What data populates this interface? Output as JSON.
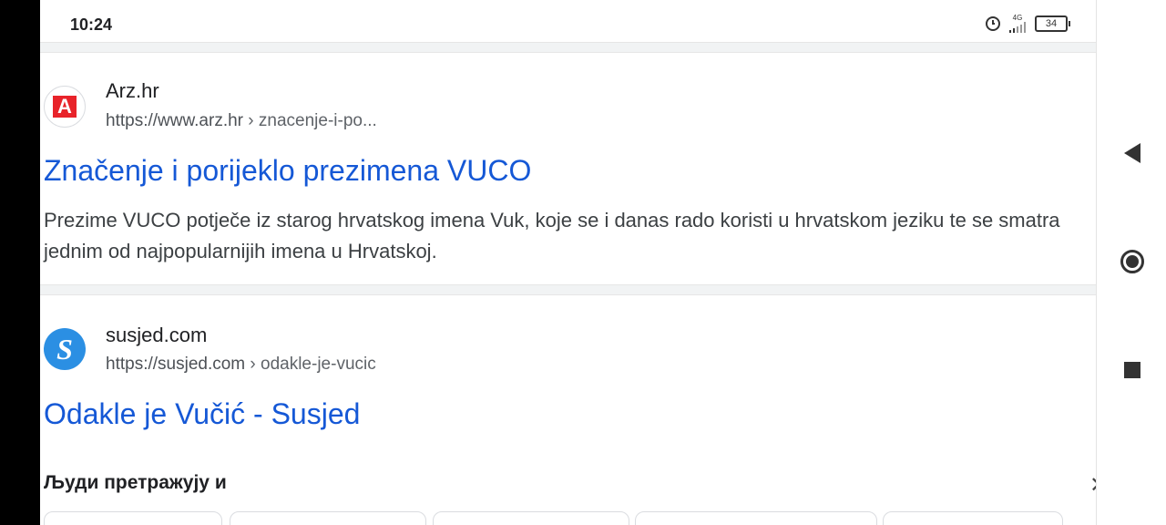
{
  "status_bar": {
    "time": "10:24",
    "network": "4G",
    "battery": "34"
  },
  "results": [
    {
      "site_name": "Arz.hr",
      "url_domain": "https://www.arz.hr",
      "url_path": " › znacenje-i-po...",
      "favicon_letter": "A",
      "title": "Značenje i porijeklo prezimena VUCO",
      "snippet": "Prezime VUCO potječe iz starog hrvatskog imena Vuk, koje se i danas rado koristi u hrvatskom jeziku te se smatra jednim od najpopularnijih imena u Hrvatskoj."
    },
    {
      "site_name": "susjed.com",
      "url_domain": "https://susjed.com",
      "url_path": " › odakle-je-vucic",
      "favicon_letter": "S",
      "title": "Odakle je Vučić - Susjed"
    }
  ],
  "people_also_search": {
    "heading": "Људи претражују и",
    "close_glyph": "✕"
  },
  "colors": {
    "link_blue": "#1558d6",
    "arz_red": "#e8232a",
    "susjed_blue": "#2b8fe3"
  }
}
